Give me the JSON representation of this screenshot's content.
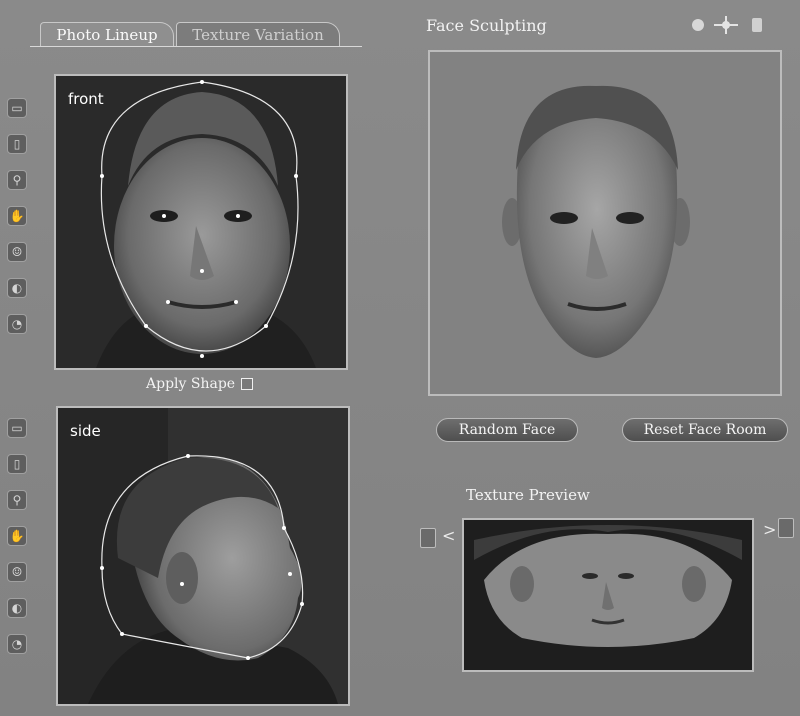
{
  "tabs": [
    {
      "label": "Photo Lineup",
      "active": true
    },
    {
      "label": "Texture Variation",
      "active": false
    }
  ],
  "face_sculpting": {
    "title": "Face Sculpting"
  },
  "photos": {
    "front_label": "front",
    "side_label": "side"
  },
  "apply_shape": {
    "label": "Apply Shape",
    "checked": false
  },
  "buttons": {
    "random_face": "Random Face",
    "reset_face_room": "Reset Face Room"
  },
  "texture_preview": {
    "title": "Texture Preview",
    "prev": "<",
    "next": ">"
  },
  "toolbar_icons": [
    "page-icon",
    "cylinder-icon",
    "magnify-icon",
    "hand-icon",
    "head-front-icon",
    "head-side-icon",
    "head-back-icon"
  ],
  "colors": {
    "panel": "#858585",
    "frame": "#bcbcbc",
    "text": "#f2f2f2",
    "button": "#5a5a5a"
  }
}
